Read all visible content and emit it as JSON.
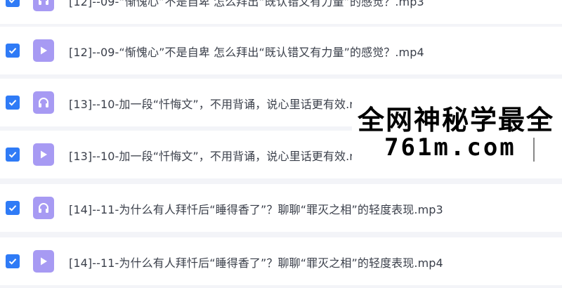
{
  "files": [
    {
      "name": "[12]--09-“惭愧心”不是自卑 怎么拜出“既认错又有力量”的感觉？.mp3",
      "type": "audio",
      "checked": true
    },
    {
      "name": "[12]--09-“惭愧心”不是自卑 怎么拜出“既认错又有力量”的感觉？.mp4",
      "type": "video",
      "checked": true
    },
    {
      "name": "[13]--10-加一段“忏悔文”，不用背诵，说心里话更有效.mp3",
      "type": "audio",
      "checked": true
    },
    {
      "name": "[13]--10-加一段“忏悔文”，不用背诵，说心里话更有效.mp4",
      "type": "video",
      "checked": true
    },
    {
      "name": "[14]--11-为什么有人拜忏后“睡得香了”？聊聊“罪灭之相”的轻度表现.mp3",
      "type": "audio",
      "checked": true
    },
    {
      "name": "[14]--11-为什么有人拜忏后“睡得香了”？聊聊“罪灭之相”的轻度表现.mp4",
      "type": "video",
      "checked": true
    }
  ],
  "watermark": {
    "line1": "全网神秘学最全",
    "line2": "761m.com"
  },
  "colors": {
    "checkbox": "#2f7bf6",
    "file_icon": "#a79af3",
    "row_bg": "#ffffff",
    "gap_bg": "#f3f4f8",
    "text": "#3a3f4a"
  }
}
